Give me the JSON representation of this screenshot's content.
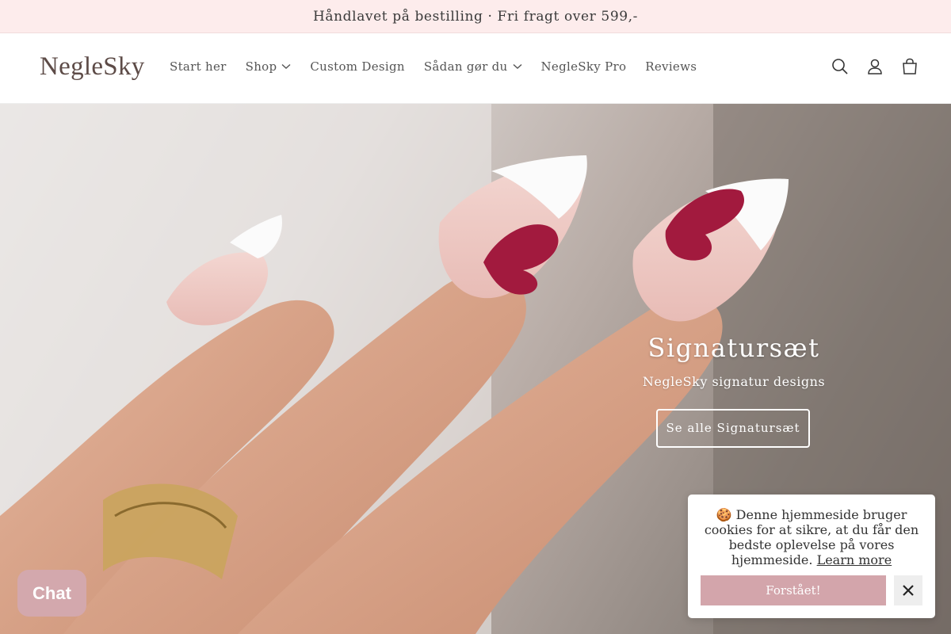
{
  "announcement": "Håndlavet på bestilling · Fri fragt over 599,-",
  "header": {
    "logo": "NegleSky",
    "nav": [
      {
        "label": "Start her",
        "dropdown": false
      },
      {
        "label": "Shop",
        "dropdown": true
      },
      {
        "label": "Custom Design",
        "dropdown": false
      },
      {
        "label": "Sådan gør du",
        "dropdown": true
      },
      {
        "label": "NegleSky Pro",
        "dropdown": false
      },
      {
        "label": "Reviews",
        "dropdown": false
      }
    ],
    "icons": [
      "search-icon",
      "account-icon",
      "cart-icon"
    ]
  },
  "hero": {
    "title": "Signatursæt",
    "subtitle": "NegleSky signatur designs",
    "button": "Se alle Signatursæt"
  },
  "chat": {
    "label": "Chat",
    "color": "#d3a8ad"
  },
  "cookie": {
    "emoji": "🍪",
    "text": "Denne hjemmeside bruger cookies for at sikre, at du får den bedste oplevelse på vores hjemmeside.",
    "link": "Learn more",
    "accept": "Forstået!",
    "accent": "#d3a5ab"
  },
  "colors": {
    "announcement_bg": "#fdecec",
    "logo": "#5d4b47",
    "accent": "#d3a5ab"
  }
}
